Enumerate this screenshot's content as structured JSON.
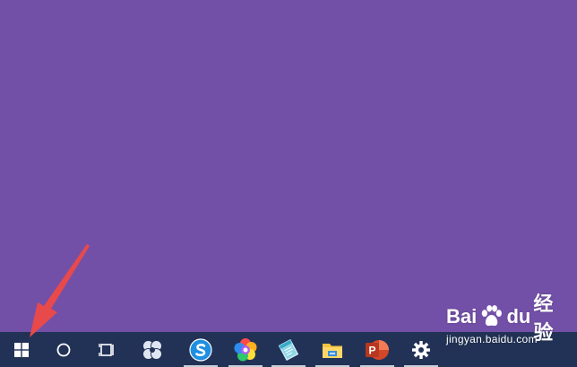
{
  "colors": {
    "desktop_background": "#7350a8",
    "taskbar_background": "#223256",
    "annotation_arrow": "#e8494a",
    "running_indicator": "#c8ced8"
  },
  "taskbar": {
    "items": [
      {
        "name": "start",
        "icon": "windows-logo-icon",
        "running": false
      },
      {
        "name": "cortana-search",
        "icon": "circle-search-icon",
        "running": false
      },
      {
        "name": "task-view",
        "icon": "task-view-icon",
        "running": false
      },
      {
        "name": "app-pinwheel",
        "icon": "pinwheel-app-icon",
        "running": false
      },
      {
        "name": "sogou-browser",
        "icon": "blue-s-browser-icon",
        "running": true
      },
      {
        "name": "color-app",
        "icon": "rainbow-flower-icon",
        "running": true
      },
      {
        "name": "notes-app",
        "icon": "tilted-notepad-icon",
        "running": true
      },
      {
        "name": "file-explorer",
        "icon": "folder-icon",
        "running": true
      },
      {
        "name": "powerpoint",
        "icon": "powerpoint-icon",
        "running": true
      },
      {
        "name": "settings",
        "icon": "gear-icon",
        "running": true
      }
    ]
  },
  "watermark": {
    "brand_left": "Bai",
    "brand_right": "du",
    "brand_cn": "经验",
    "url": "jingyan.baidu.com"
  }
}
